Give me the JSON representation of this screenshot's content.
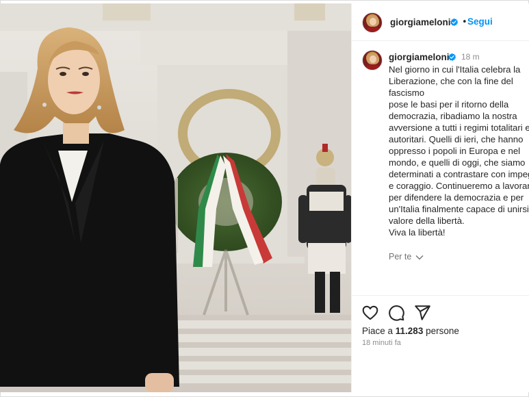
{
  "post": {
    "username": "giorgiameloni",
    "follow_label": "Segui",
    "separator": "•",
    "caption_username": "giorgiameloni",
    "time_short": "18 m",
    "caption_lines": "Nel giorno in cui l'Italia celebra la\nLiberazione, che con la fine del fascismo\npose le basi per il ritorno della\ndemocrazia, ribadiamo la nostra\navversione a tutti i regimi totalitari e\nautoritari. Quelli di ieri, che hanno\noppresso i popoli in Europa e nel\nmondo, e quelli di oggi, che siamo\ndeterminati a contrastare con impegno\ne coraggio. Continueremo a lavorare\nper difendere la democrazia e per\nun'Italia finalmente capace di unirsi sul\nvalore della libertà.",
    "caption_closing": "Viva la libertà!",
    "see_translation": "Per te",
    "likes_prefix": "Piace a ",
    "likes_count": "11.283",
    "likes_suffix": " persone",
    "time_long": "18 minuti fa"
  },
  "icons": {
    "verified": "verified-badge-icon",
    "like": "heart-icon",
    "comment": "comment-icon",
    "share": "send-icon",
    "chevron": "chevron-down-icon"
  },
  "colors": {
    "accent": "#0095f6",
    "text": "#262626",
    "muted": "#8e8e8e"
  }
}
